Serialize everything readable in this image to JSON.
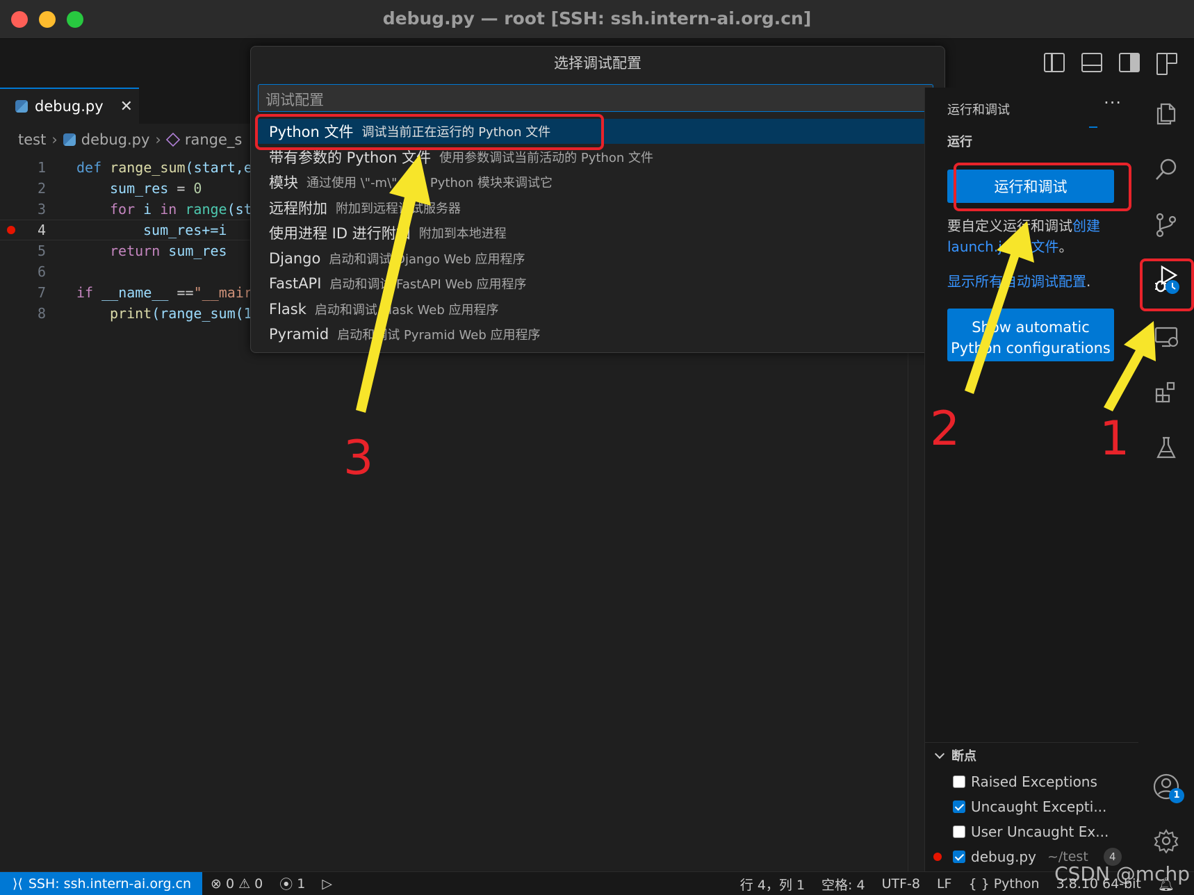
{
  "window": {
    "title": "debug.py — root [SSH: ssh.intern-ai.org.cn]"
  },
  "tabs": [
    {
      "label": "debug.py",
      "close": "✕",
      "icon": "python-file-icon"
    }
  ],
  "breadcrumb": {
    "folder": "test",
    "file": "debug.py",
    "symbol": "range_s"
  },
  "editor": {
    "lines": [
      {
        "num": "1"
      },
      {
        "num": "2"
      },
      {
        "num": "3"
      },
      {
        "num": "4"
      },
      {
        "num": "5"
      },
      {
        "num": "6"
      },
      {
        "num": "7"
      },
      {
        "num": "8"
      }
    ],
    "tokens": {
      "l1_kw": "def",
      "l1_fn": "range_sum",
      "l1_rest": "(start,e",
      "l2_var": "sum_res",
      "l2_eq": " = ",
      "l2_num": "0",
      "l3_for": "for",
      "l3_i": " i ",
      "l3_in": "in",
      "l3_range": " range",
      "l3_rest": "(st",
      "l4_code": "sum_res+=i",
      "l5_ret": "return",
      "l5_var": " sum_res",
      "l7_if": "if",
      "l7_name": " __name__ ",
      "l7_eq": "==",
      "l7_str": "\"__mair",
      "l8_fn": "print",
      "l8_rest": "(range_sum(1"
    }
  },
  "quickpick": {
    "title": "选择调试配置",
    "placeholder": "调试配置",
    "items": [
      {
        "label": "Python 文件",
        "desc": "调试当前正在运行的 Python 文件"
      },
      {
        "label": "带有参数的 Python 文件",
        "desc": "使用参数调试当前活动的 Python 文件"
      },
      {
        "label": "模块",
        "desc": "通过使用 \\\"-m\\\" 调用 Python 模块来调试它"
      },
      {
        "label": "远程附加",
        "desc": "附加到远程调试服务器"
      },
      {
        "label": "使用进程 ID 进行附加",
        "desc": "附加到本地进程"
      },
      {
        "label": "Django",
        "desc": "启动和调试 Django Web 应用程序"
      },
      {
        "label": "FastAPI",
        "desc": "启动和调试 FastAPI Web 应用程序"
      },
      {
        "label": "Flask",
        "desc": "启动和调试 Flask Web 应用程序"
      },
      {
        "label": "Pyramid",
        "desc": "启动和调试 Pyramid Web 应用程序"
      }
    ]
  },
  "sidebar": {
    "header": "运行和调试",
    "more": "···",
    "section": "运行",
    "run_button": "运行和调试",
    "customize_text": "要自定义运行和调试",
    "create_link": "创建",
    "launch_link": "launch.json 文件",
    "period": "。",
    "show_all_link": "显示所有自动调试配置",
    "show_all_period": ".",
    "auto_button_line1": "Show automatic",
    "auto_button_line2": "Python configurations",
    "breakpoints": {
      "title": "断点",
      "items": [
        {
          "label": "Raised Exceptions",
          "checked": false
        },
        {
          "label": "Uncaught Excepti...",
          "checked": true
        },
        {
          "label": "User Uncaught Ex...",
          "checked": false
        },
        {
          "label": "debug.py",
          "path": "~/test",
          "count": "4",
          "checked": true
        }
      ]
    }
  },
  "activitybar": {
    "icons": [
      "explorer-icon",
      "search-icon",
      "source-control-icon",
      "run-debug-icon",
      "remote-explorer-icon",
      "extensions-icon",
      "testing-icon",
      "account-icon",
      "settings-gear-icon"
    ],
    "account_badge": "1"
  },
  "statusbar": {
    "remote": "SSH: ssh.intern-ai.org.cn",
    "errors": "0",
    "warnings": "0",
    "ports": "1",
    "position": "行 4，列 1",
    "spaces": "空格: 4",
    "encoding": "UTF-8",
    "eol": "LF",
    "language_braces": "{ }",
    "language": "Python",
    "interpreter": "3.8.10 64-bit"
  },
  "annotations": {
    "n1": "1",
    "n2": "2",
    "n3": "3",
    "arrow_color": "#f7e52a",
    "box_color": "#e8232a"
  },
  "watermark": "CSDN @mchp"
}
